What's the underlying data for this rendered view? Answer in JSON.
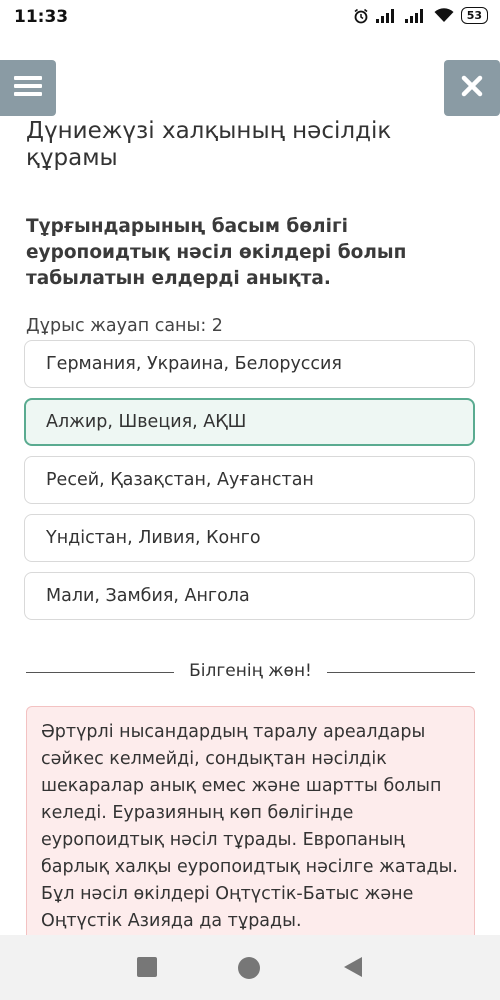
{
  "status_bar": {
    "time": "11:33",
    "battery": "53",
    "icons": [
      "alarm-icon",
      "signal-icon",
      "signal-icon",
      "wifi-icon",
      "battery-icon"
    ]
  },
  "header": {
    "menu_icon": "hamburger-icon",
    "close_icon": "close-icon",
    "button_color": "#8a9ba4"
  },
  "quiz": {
    "title": "Дүниежүзі халқының нәсілдік құрамы",
    "question": "Тұрғындарының басым бөлігі еуропоидтық нәсіл өкілдері болып табылатын елдерді анықта.",
    "answer_count": "Дұрыс жауап саны: 2",
    "options": [
      {
        "label": "Германия, Украина, Белоруссия",
        "selected": false
      },
      {
        "label": "Алжир, Швеция, АҚШ",
        "selected": true
      },
      {
        "label": "Ресей, Қазақстан, Ауғанстан",
        "selected": false
      },
      {
        "label": "Үндістан, Ливия, Конго",
        "selected": false
      },
      {
        "label": "Мали, Замбия, Ангола",
        "selected": false
      }
    ],
    "selected_color": "#5aab90"
  },
  "info": {
    "heading": "Білгенің жөн!",
    "text": "Әртүрлі нысандардың таралу ареалдары сәйкес келмейді, сондықтан нәсілдік шекаралар анық емес және шартты болып келеді. Еуразияның көп бөлігінде еуропоидтық нәсіл тұрады. Европаның барлық халқы еуропоидтық нәсілге жатады. Бұл нәсіл өкілдері Оңтүстік-Батыс және Оңтүстік Азияда да тұрады.",
    "box_color": "#fdecec"
  },
  "navbar": {
    "icons": [
      "recent-apps-icon",
      "home-icon",
      "back-icon"
    ]
  }
}
